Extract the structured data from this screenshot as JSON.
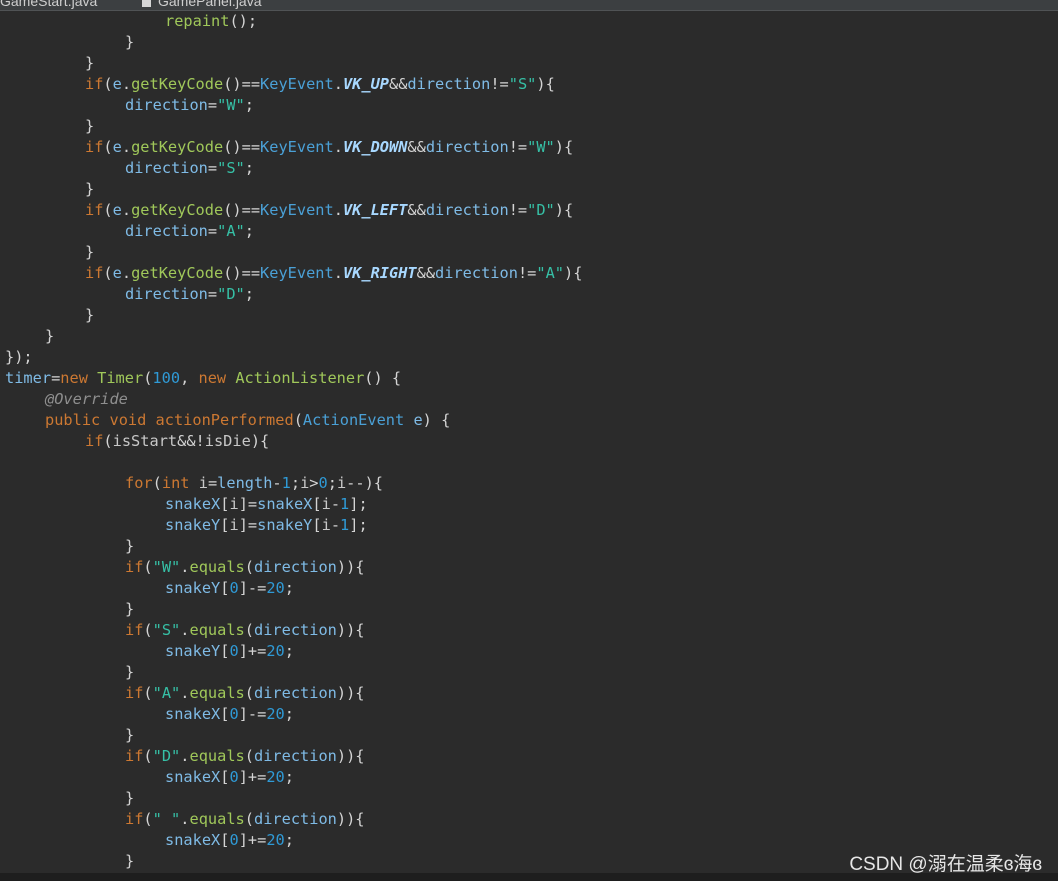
{
  "tabs": [
    {
      "label": "GameStart.java"
    },
    {
      "label": "GamePanel.java"
    }
  ],
  "code_lines": [
    [
      {
        "t": "repaint",
        "c": "fn"
      },
      {
        "t": "();",
        "c": "pun"
      }
    ],
    [
      {
        "t": "}",
        "c": "pun"
      }
    ],
    [
      {
        "t": "}",
        "c": "pun"
      }
    ],
    [
      {
        "t": "if",
        "c": "kw"
      },
      {
        "t": "(",
        "c": "pun"
      },
      {
        "t": "e",
        "c": "var"
      },
      {
        "t": ".",
        "c": "pun"
      },
      {
        "t": "getKeyCode",
        "c": "fn"
      },
      {
        "t": "()==",
        "c": "pun"
      },
      {
        "t": "KeyEvent",
        "c": "type"
      },
      {
        "t": ".",
        "c": "pun"
      },
      {
        "t": "VK_UP",
        "c": "const"
      },
      {
        "t": "&&",
        "c": "pun"
      },
      {
        "t": "direction",
        "c": "var"
      },
      {
        "t": "!=",
        "c": "pun"
      },
      {
        "t": "\"S\"",
        "c": "str"
      },
      {
        "t": "){",
        "c": "pun"
      }
    ],
    [
      {
        "t": "direction",
        "c": "var"
      },
      {
        "t": "=",
        "c": "pun"
      },
      {
        "t": "\"W\"",
        "c": "str"
      },
      {
        "t": ";",
        "c": "pun"
      }
    ],
    [
      {
        "t": "}",
        "c": "pun"
      }
    ],
    [
      {
        "t": "if",
        "c": "kw"
      },
      {
        "t": "(",
        "c": "pun"
      },
      {
        "t": "e",
        "c": "var"
      },
      {
        "t": ".",
        "c": "pun"
      },
      {
        "t": "getKeyCode",
        "c": "fn"
      },
      {
        "t": "()==",
        "c": "pun"
      },
      {
        "t": "KeyEvent",
        "c": "type"
      },
      {
        "t": ".",
        "c": "pun"
      },
      {
        "t": "VK_DOWN",
        "c": "const"
      },
      {
        "t": "&&",
        "c": "pun"
      },
      {
        "t": "direction",
        "c": "var"
      },
      {
        "t": "!=",
        "c": "pun"
      },
      {
        "t": "\"W\"",
        "c": "str"
      },
      {
        "t": "){",
        "c": "pun"
      }
    ],
    [
      {
        "t": "direction",
        "c": "var"
      },
      {
        "t": "=",
        "c": "pun"
      },
      {
        "t": "\"S\"",
        "c": "str"
      },
      {
        "t": ";",
        "c": "pun"
      }
    ],
    [
      {
        "t": "}",
        "c": "pun"
      }
    ],
    [
      {
        "t": "if",
        "c": "kw"
      },
      {
        "t": "(",
        "c": "pun"
      },
      {
        "t": "e",
        "c": "var"
      },
      {
        "t": ".",
        "c": "pun"
      },
      {
        "t": "getKeyCode",
        "c": "fn"
      },
      {
        "t": "()==",
        "c": "pun"
      },
      {
        "t": "KeyEvent",
        "c": "type"
      },
      {
        "t": ".",
        "c": "pun"
      },
      {
        "t": "VK_LEFT",
        "c": "const"
      },
      {
        "t": "&&",
        "c": "pun"
      },
      {
        "t": "direction",
        "c": "var"
      },
      {
        "t": "!=",
        "c": "pun"
      },
      {
        "t": "\"D\"",
        "c": "str"
      },
      {
        "t": "){",
        "c": "pun"
      }
    ],
    [
      {
        "t": "direction",
        "c": "var"
      },
      {
        "t": "=",
        "c": "pun"
      },
      {
        "t": "\"A\"",
        "c": "str"
      },
      {
        "t": ";",
        "c": "pun"
      }
    ],
    [
      {
        "t": "}",
        "c": "pun"
      }
    ],
    [
      {
        "t": "if",
        "c": "kw"
      },
      {
        "t": "(",
        "c": "pun"
      },
      {
        "t": "e",
        "c": "var"
      },
      {
        "t": ".",
        "c": "pun"
      },
      {
        "t": "getKeyCode",
        "c": "fn"
      },
      {
        "t": "()==",
        "c": "pun"
      },
      {
        "t": "KeyEvent",
        "c": "type"
      },
      {
        "t": ".",
        "c": "pun"
      },
      {
        "t": "VK_RIGHT",
        "c": "const"
      },
      {
        "t": "&&",
        "c": "pun"
      },
      {
        "t": "direction",
        "c": "var"
      },
      {
        "t": "!=",
        "c": "pun"
      },
      {
        "t": "\"A\"",
        "c": "str"
      },
      {
        "t": "){",
        "c": "pun"
      }
    ],
    [
      {
        "t": "direction",
        "c": "var"
      },
      {
        "t": "=",
        "c": "pun"
      },
      {
        "t": "\"D\"",
        "c": "str"
      },
      {
        "t": ";",
        "c": "pun"
      }
    ],
    [
      {
        "t": "}",
        "c": "pun"
      }
    ],
    [
      {
        "t": "}",
        "c": "pun"
      }
    ],
    [
      {
        "t": "});",
        "c": "pun"
      }
    ],
    [
      {
        "t": "timer",
        "c": "var"
      },
      {
        "t": "=",
        "c": "pun"
      },
      {
        "t": "new",
        "c": "kw"
      },
      {
        "t": " ",
        "c": "pun"
      },
      {
        "t": "Timer",
        "c": "fn"
      },
      {
        "t": "(",
        "c": "pun"
      },
      {
        "t": "100",
        "c": "num"
      },
      {
        "t": ", ",
        "c": "pun"
      },
      {
        "t": "new",
        "c": "kw"
      },
      {
        "t": " ",
        "c": "pun"
      },
      {
        "t": "ActionListener",
        "c": "fn"
      },
      {
        "t": "() {",
        "c": "pun"
      }
    ],
    [
      {
        "t": "@Override",
        "c": "ann"
      }
    ],
    [
      {
        "t": "public",
        "c": "kw"
      },
      {
        "t": " ",
        "c": "pun"
      },
      {
        "t": "void",
        "c": "kw"
      },
      {
        "t": " ",
        "c": "pun"
      },
      {
        "t": "actionPerformed",
        "c": "kw"
      },
      {
        "t": "(",
        "c": "pun"
      },
      {
        "t": "ActionEvent",
        "c": "type"
      },
      {
        "t": " ",
        "c": "pun"
      },
      {
        "t": "e",
        "c": "var"
      },
      {
        "t": ") {",
        "c": "pun"
      }
    ],
    [
      {
        "t": "if",
        "c": "kw"
      },
      {
        "t": "(",
        "c": "pun"
      },
      {
        "t": "isStart",
        "c": "plain"
      },
      {
        "t": "&&!",
        "c": "pun"
      },
      {
        "t": "isDie",
        "c": "plain"
      },
      {
        "t": "){",
        "c": "pun"
      }
    ],
    [],
    [
      {
        "t": "for",
        "c": "kw"
      },
      {
        "t": "(",
        "c": "pun"
      },
      {
        "t": "int",
        "c": "kw"
      },
      {
        "t": " ",
        "c": "pun"
      },
      {
        "t": "i",
        "c": "plain"
      },
      {
        "t": "=",
        "c": "pun"
      },
      {
        "t": "length",
        "c": "var"
      },
      {
        "t": "-",
        "c": "pun"
      },
      {
        "t": "1",
        "c": "num"
      },
      {
        "t": ";",
        "c": "pun"
      },
      {
        "t": "i",
        "c": "plain"
      },
      {
        "t": ">",
        "c": "pun"
      },
      {
        "t": "0",
        "c": "num"
      },
      {
        "t": ";",
        "c": "pun"
      },
      {
        "t": "i",
        "c": "plain"
      },
      {
        "t": "--){",
        "c": "pun"
      }
    ],
    [
      {
        "t": "snakeX",
        "c": "var"
      },
      {
        "t": "[",
        "c": "pun"
      },
      {
        "t": "i",
        "c": "plain"
      },
      {
        "t": "]=",
        "c": "pun"
      },
      {
        "t": "snakeX",
        "c": "var"
      },
      {
        "t": "[",
        "c": "pun"
      },
      {
        "t": "i",
        "c": "plain"
      },
      {
        "t": "-",
        "c": "pun"
      },
      {
        "t": "1",
        "c": "num"
      },
      {
        "t": "];",
        "c": "pun"
      }
    ],
    [
      {
        "t": "snakeY",
        "c": "var"
      },
      {
        "t": "[",
        "c": "pun"
      },
      {
        "t": "i",
        "c": "plain"
      },
      {
        "t": "]=",
        "c": "pun"
      },
      {
        "t": "snakeY",
        "c": "var"
      },
      {
        "t": "[",
        "c": "pun"
      },
      {
        "t": "i",
        "c": "plain"
      },
      {
        "t": "-",
        "c": "pun"
      },
      {
        "t": "1",
        "c": "num"
      },
      {
        "t": "];",
        "c": "pun"
      }
    ],
    [
      {
        "t": "}",
        "c": "pun"
      }
    ],
    [
      {
        "t": "if",
        "c": "kw"
      },
      {
        "t": "(",
        "c": "pun"
      },
      {
        "t": "\"W\"",
        "c": "str"
      },
      {
        "t": ".",
        "c": "pun"
      },
      {
        "t": "equals",
        "c": "fn"
      },
      {
        "t": "(",
        "c": "pun"
      },
      {
        "t": "direction",
        "c": "var"
      },
      {
        "t": ")){",
        "c": "pun"
      }
    ],
    [
      {
        "t": "snakeY",
        "c": "var"
      },
      {
        "t": "[",
        "c": "pun"
      },
      {
        "t": "0",
        "c": "num"
      },
      {
        "t": "]-=",
        "c": "pun"
      },
      {
        "t": "20",
        "c": "num"
      },
      {
        "t": ";",
        "c": "pun"
      }
    ],
    [
      {
        "t": "}",
        "c": "pun"
      }
    ],
    [
      {
        "t": "if",
        "c": "kw"
      },
      {
        "t": "(",
        "c": "pun"
      },
      {
        "t": "\"S\"",
        "c": "str"
      },
      {
        "t": ".",
        "c": "pun"
      },
      {
        "t": "equals",
        "c": "fn"
      },
      {
        "t": "(",
        "c": "pun"
      },
      {
        "t": "direction",
        "c": "var"
      },
      {
        "t": ")){",
        "c": "pun"
      }
    ],
    [
      {
        "t": "snakeY",
        "c": "var"
      },
      {
        "t": "[",
        "c": "pun"
      },
      {
        "t": "0",
        "c": "num"
      },
      {
        "t": "]+=",
        "c": "pun"
      },
      {
        "t": "20",
        "c": "num"
      },
      {
        "t": ";",
        "c": "pun"
      }
    ],
    [
      {
        "t": "}",
        "c": "pun"
      }
    ],
    [
      {
        "t": "if",
        "c": "kw"
      },
      {
        "t": "(",
        "c": "pun"
      },
      {
        "t": "\"A\"",
        "c": "str"
      },
      {
        "t": ".",
        "c": "pun"
      },
      {
        "t": "equals",
        "c": "fn"
      },
      {
        "t": "(",
        "c": "pun"
      },
      {
        "t": "direction",
        "c": "var"
      },
      {
        "t": ")){",
        "c": "pun"
      }
    ],
    [
      {
        "t": "snakeX",
        "c": "var"
      },
      {
        "t": "[",
        "c": "pun"
      },
      {
        "t": "0",
        "c": "num"
      },
      {
        "t": "]-=",
        "c": "pun"
      },
      {
        "t": "20",
        "c": "num"
      },
      {
        "t": ";",
        "c": "pun"
      }
    ],
    [
      {
        "t": "}",
        "c": "pun"
      }
    ],
    [
      {
        "t": "if",
        "c": "kw"
      },
      {
        "t": "(",
        "c": "pun"
      },
      {
        "t": "\"D\"",
        "c": "str"
      },
      {
        "t": ".",
        "c": "pun"
      },
      {
        "t": "equals",
        "c": "fn"
      },
      {
        "t": "(",
        "c": "pun"
      },
      {
        "t": "direction",
        "c": "var"
      },
      {
        "t": ")){",
        "c": "pun"
      }
    ],
    [
      {
        "t": "snakeX",
        "c": "var"
      },
      {
        "t": "[",
        "c": "pun"
      },
      {
        "t": "0",
        "c": "num"
      },
      {
        "t": "]+=",
        "c": "pun"
      },
      {
        "t": "20",
        "c": "num"
      },
      {
        "t": ";",
        "c": "pun"
      }
    ],
    [
      {
        "t": "}",
        "c": "pun"
      }
    ],
    [
      {
        "t": "if",
        "c": "kw"
      },
      {
        "t": "(",
        "c": "pun"
      },
      {
        "t": "\" \"",
        "c": "str"
      },
      {
        "t": ".",
        "c": "pun"
      },
      {
        "t": "equals",
        "c": "fn"
      },
      {
        "t": "(",
        "c": "pun"
      },
      {
        "t": "direction",
        "c": "var"
      },
      {
        "t": ")){",
        "c": "pun"
      }
    ],
    [
      {
        "t": "snakeX",
        "c": "var"
      },
      {
        "t": "[",
        "c": "pun"
      },
      {
        "t": "0",
        "c": "num"
      },
      {
        "t": "]+=",
        "c": "pun"
      },
      {
        "t": "20",
        "c": "num"
      },
      {
        "t": ";",
        "c": "pun"
      }
    ],
    [
      {
        "t": "}",
        "c": "pun"
      }
    ]
  ],
  "watermark": "CSDN @溺在温柔ɞ海ɞ"
}
